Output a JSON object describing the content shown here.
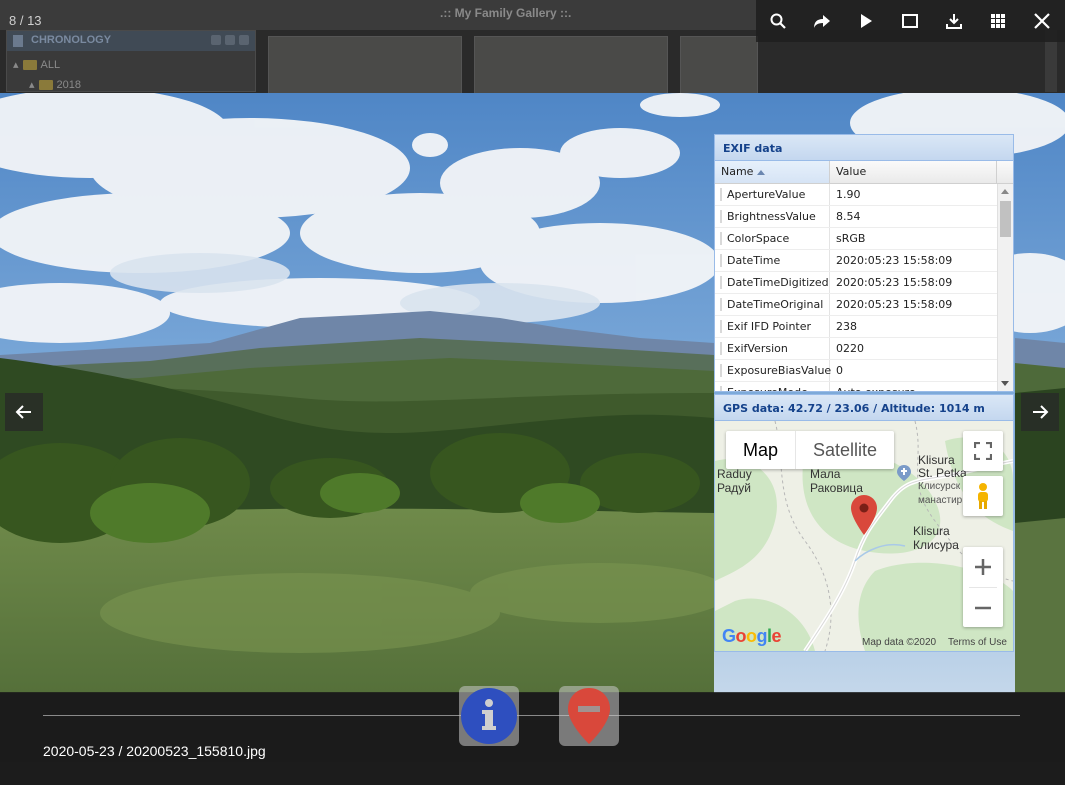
{
  "background_app": {
    "title": ".:: My Family Gallery ::.",
    "panel_title": "CHRONOLOGY",
    "tree": [
      "ALL",
      "2018"
    ]
  },
  "viewer": {
    "counter": "8 / 13",
    "toolbar": [
      {
        "id": "search",
        "icon": "search-icon"
      },
      {
        "id": "share",
        "icon": "share-icon"
      },
      {
        "id": "slideshow",
        "icon": "play-icon"
      },
      {
        "id": "fullscreen",
        "icon": "fullscreen-icon"
      },
      {
        "id": "download",
        "icon": "download-icon"
      },
      {
        "id": "thumbnails",
        "icon": "grid-icon"
      },
      {
        "id": "close",
        "icon": "close-icon"
      }
    ],
    "caption": "2020-05-23 / 20200523_155810.jpg"
  },
  "exif": {
    "title": "EXIF data",
    "columns": {
      "name": "Name",
      "value": "Value"
    },
    "rows": [
      {
        "name": "ApertureValue",
        "value": "1.90"
      },
      {
        "name": "BrightnessValue",
        "value": "8.54"
      },
      {
        "name": "ColorSpace",
        "value": "sRGB"
      },
      {
        "name": "DateTime",
        "value": "2020:05:23 15:58:09"
      },
      {
        "name": "DateTimeDigitized",
        "value": "2020:05:23 15:58:09"
      },
      {
        "name": "DateTimeOriginal",
        "value": "2020:05:23 15:58:09"
      },
      {
        "name": "Exif IFD Pointer",
        "value": "238"
      },
      {
        "name": "ExifVersion",
        "value": "0220"
      },
      {
        "name": "ExposureBiasValue",
        "value": "0"
      },
      {
        "name": "ExposureMode",
        "value": "Auto exposure"
      }
    ]
  },
  "gps": {
    "title": "GPS data: 42.72 / 23.06 / Altitude: 1014 m",
    "map": {
      "type_map": "Map",
      "type_satellite": "Satellite",
      "labels": {
        "raduy_en": "Raduy",
        "raduy_bg": "Радуй",
        "mala_1": "Мала",
        "mala_2": "Раковица",
        "klisura_en": "Klisura",
        "klisura_bg": "Клисура",
        "st_petka": "St. Petka",
        "monastery_1": "Клисурск",
        "monastery_2": "манастир"
      },
      "google": "Google",
      "map_data": "Map data ©2020",
      "terms": "Terms of Use"
    }
  },
  "colors": {
    "exif_header": "#15428b",
    "info_button": "#2e4fbf",
    "pin": "#d9483b"
  }
}
